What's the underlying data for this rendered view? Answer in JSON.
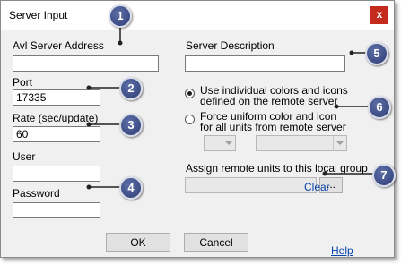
{
  "window": {
    "title": "Server Input",
    "close_label": "x"
  },
  "fields": {
    "avl_server_address": {
      "label": "Avl Server Address",
      "value": ""
    },
    "server_description": {
      "label": "Server Description",
      "value": ""
    },
    "port": {
      "label": "Port",
      "value": "17335"
    },
    "rate": {
      "label": "Rate (sec/update)",
      "value": "60"
    },
    "user": {
      "label": "User",
      "value": ""
    },
    "password": {
      "label": "Password",
      "value": ""
    }
  },
  "color_options": {
    "individual": {
      "line1": "Use individual colors and icons",
      "line2": "defined on the remote server",
      "checked": true
    },
    "uniform": {
      "line1": "Force uniform color and icon",
      "line2": "for all units from remote server",
      "checked": false
    },
    "color_select": "",
    "icon_select": ""
  },
  "group": {
    "label": "Assign remote units to this local group",
    "value": "",
    "browse_label": "...",
    "clear_label": "Clear"
  },
  "buttons": {
    "ok": "OK",
    "cancel": "Cancel",
    "help": "Help"
  },
  "callouts": [
    "1",
    "2",
    "3",
    "4",
    "5",
    "6",
    "7"
  ],
  "colors": {
    "callout": "#2e3c74",
    "close": "#c42b1c",
    "link": "#0645ad"
  }
}
